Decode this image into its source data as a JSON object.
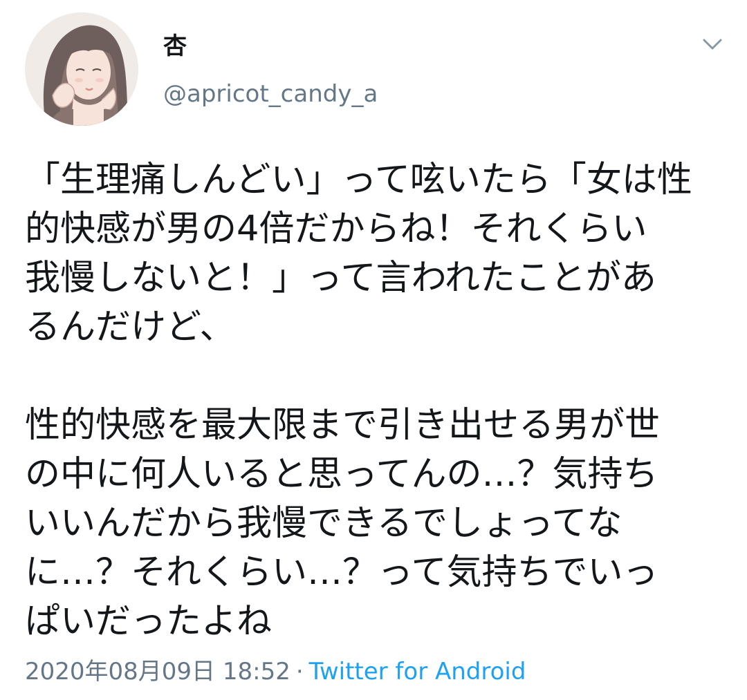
{
  "user": {
    "display_name": "杏",
    "handle": "@apricot_candy_a",
    "avatar_icon": "avatar-illustration",
    "menu_icon": "chevron-down-icon"
  },
  "tweet": {
    "paragraph1": [
      "「生理痛しんどい」って呟いたら「女は性",
      "的快感が男の4倍だからね！それくらい",
      "我慢しないと！」って言われたことがあ",
      "るんだけど、"
    ],
    "paragraph2": [
      "性的快感を最大限まで引き出せる男が世",
      "の中に何人いると思ってんの…？気持ち",
      "いいんだから我慢できるでしょってな",
      "に…？それくらい…？って気持ちでいっ",
      "ぱいだったよね"
    ]
  },
  "meta": {
    "timestamp": "2020年08月09日 18:52",
    "separator": "·",
    "source": "Twitter for Android"
  },
  "colors": {
    "text": "#14171a",
    "secondary": "#657786",
    "link": "#1da1f2"
  }
}
